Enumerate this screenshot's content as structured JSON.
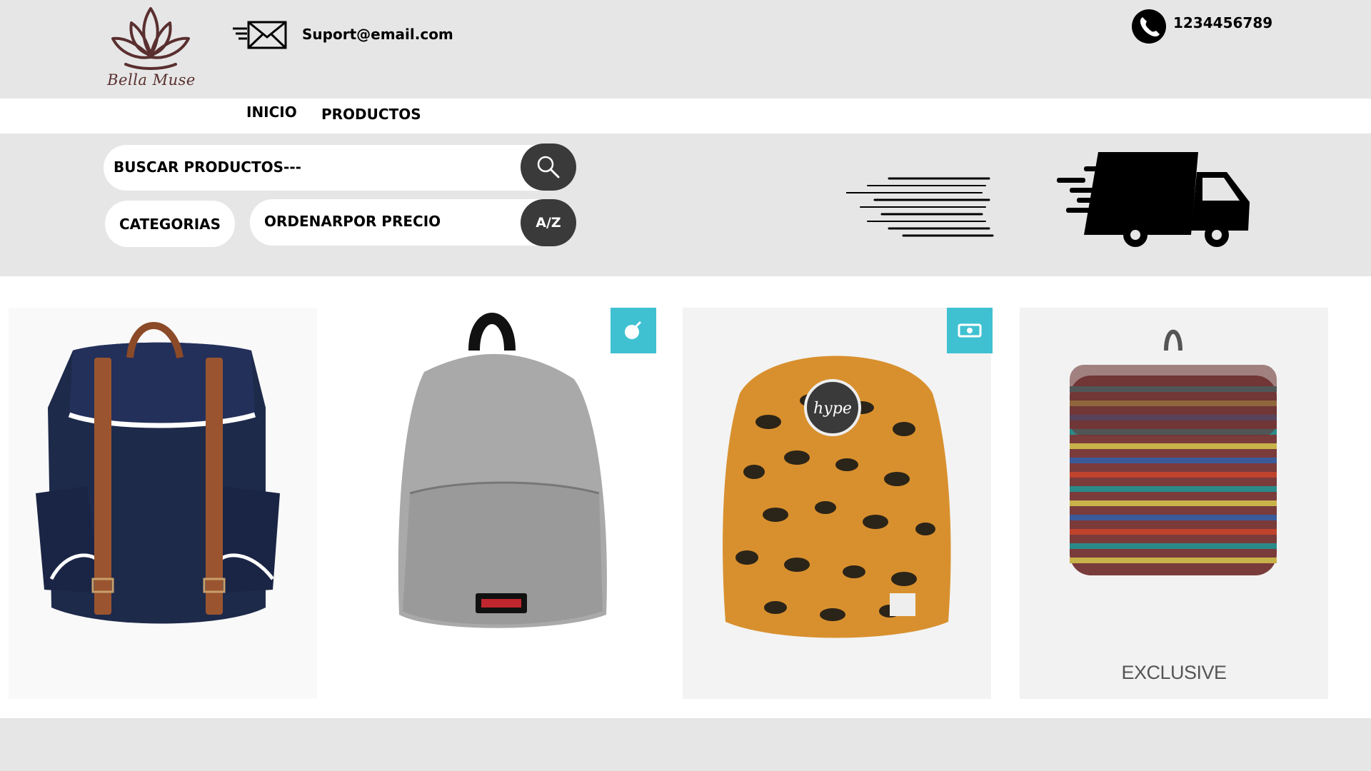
{
  "brand": {
    "logo_text": "Bella Muse",
    "logo_color": "#5a2f2f"
  },
  "contact": {
    "email": "Suport@email.com",
    "phone": "1234456789"
  },
  "nav": {
    "items": [
      {
        "label": "INICIO"
      },
      {
        "label": "PRODUCTOS"
      }
    ]
  },
  "filters": {
    "search_placeholder": "BUSCAR PRODUCTOS---",
    "categories_label": "CATEGORIAS",
    "order_label": "ORDENARPOR PRECIO",
    "order_button": "A/Z"
  },
  "products": [
    {
      "name": "navy-backpack",
      "color": "#1e2a4a"
    },
    {
      "name": "grey-backpack",
      "color": "#a9a9a9"
    },
    {
      "name": "leopard-backpack",
      "color": "#d8902e"
    },
    {
      "name": "striped-backpack",
      "color": "#7a3b3b",
      "caption": "EXCLUSIVE"
    }
  ],
  "badges": [
    {
      "icon": "bomb-icon"
    },
    {
      "icon": "cash-icon"
    }
  ],
  "colors": {
    "background": "#e6e6e6",
    "button_dark": "#3a3a3a",
    "badge": "#40c1d2"
  }
}
